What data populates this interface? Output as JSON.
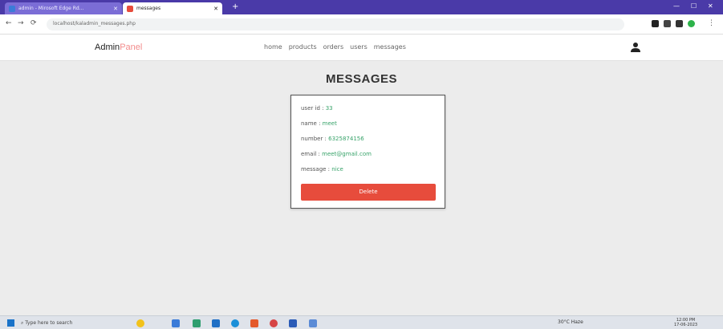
{
  "browser": {
    "tabs": [
      {
        "label": "admin - Mirosoft Edge Rd..."
      },
      {
        "label": "messages"
      }
    ],
    "new_tab": "+",
    "url": "localhost/kaladmin_messages.php"
  },
  "header": {
    "logo_main": "Admin",
    "logo_accent": "Panel",
    "nav": [
      "home",
      "products",
      "orders",
      "users",
      "messages"
    ]
  },
  "page": {
    "title": "MESSAGES"
  },
  "message": {
    "fields": [
      {
        "label": "user id : ",
        "value": "33"
      },
      {
        "label": "name : ",
        "value": "meet"
      },
      {
        "label": "number : ",
        "value": "6325874156"
      },
      {
        "label": "email : ",
        "value": "meet@gmail.com"
      },
      {
        "label": "message : ",
        "value": "nice"
      }
    ],
    "delete_label": "Delete"
  },
  "taskbar": {
    "search_placeholder": "Type here to search",
    "weather": "30°C Haze",
    "time": "12:00 PM",
    "date": "17-06-2023"
  },
  "colors": {
    "accent_value": "#38a36a",
    "delete": "#e74c3c",
    "logo_accent": "#f28c8c"
  }
}
